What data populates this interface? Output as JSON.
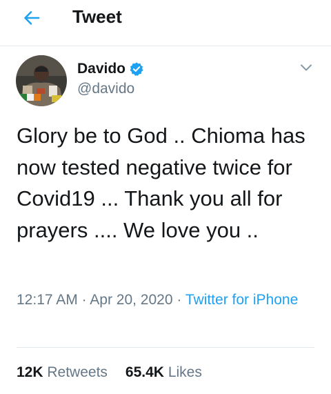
{
  "header": {
    "title": "Tweet",
    "back_icon": "arrow-left-icon",
    "accent_color": "#1da1f2"
  },
  "author": {
    "name": "Davido",
    "handle": "@davido",
    "verified": true,
    "avatar_icon": "profile-photo"
  },
  "tweet": {
    "text": "Glory be to God .. Chioma has now tested negative twice for Covid19 ... Thank you all for prayers .... We love you ..",
    "time": "12:17 AM",
    "separator": "·",
    "date": "Apr 20, 2020",
    "source": "Twitter for iPhone"
  },
  "stats": {
    "retweets_count": "12K",
    "retweets_label": "Retweets",
    "likes_count": "65.4K",
    "likes_label": "Likes"
  },
  "colors": {
    "text_primary": "#14171a",
    "text_secondary": "#657786",
    "link": "#1da1f2",
    "border": "#e1e8ed"
  }
}
